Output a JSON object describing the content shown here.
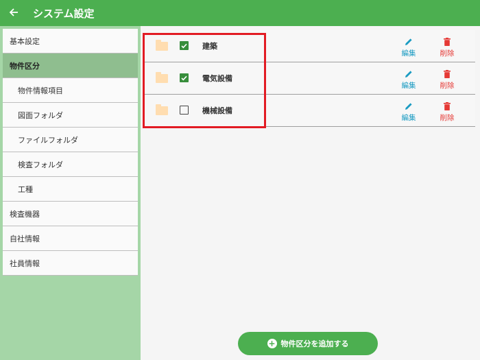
{
  "appbar": {
    "back_icon": "arrow-left-icon",
    "title": "システム設定"
  },
  "sidebar": {
    "items": [
      {
        "label": "基本設定",
        "level": 0,
        "active": false
      },
      {
        "label": "物件区分",
        "level": 0,
        "active": true
      },
      {
        "label": "物件情報項目",
        "level": 1,
        "active": false
      },
      {
        "label": "図面フォルダ",
        "level": 1,
        "active": false
      },
      {
        "label": "ファイルフォルダ",
        "level": 1,
        "active": false
      },
      {
        "label": "検査フォルダ",
        "level": 1,
        "active": false
      },
      {
        "label": "工種",
        "level": 1,
        "active": false
      },
      {
        "label": "検査機器",
        "level": 0,
        "active": false
      },
      {
        "label": "自社情報",
        "level": 0,
        "active": false
      },
      {
        "label": "社員情報",
        "level": 0,
        "active": false
      }
    ]
  },
  "list": {
    "rows": [
      {
        "name": "建築",
        "checked": true,
        "edit_label": "編集",
        "delete_label": "削除"
      },
      {
        "name": "電気設備",
        "checked": true,
        "edit_label": "編集",
        "delete_label": "削除"
      },
      {
        "name": "機械設備",
        "checked": false,
        "edit_label": "編集",
        "delete_label": "削除"
      }
    ]
  },
  "add_button": {
    "label": "物件区分を追加する",
    "icon": "plus-circle-icon"
  },
  "colors": {
    "primary": "#4caf50",
    "sidebar_bg": "#a5d6a7",
    "active_item": "#8fbe8f",
    "checkbox_on": "#388e3c",
    "edit": "#1a9bc2",
    "delete": "#e53935",
    "highlight": "#e21b23",
    "folder": "#ffddb0"
  }
}
